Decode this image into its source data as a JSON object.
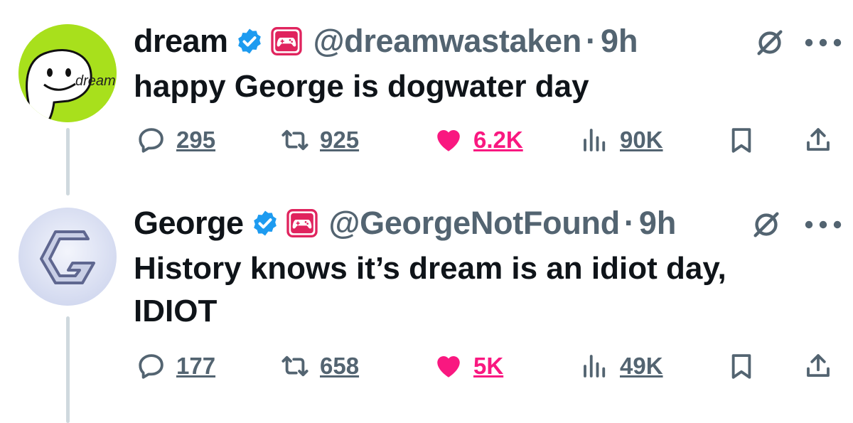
{
  "tweets": [
    {
      "name": "dream",
      "handle": "@dreamwastaken",
      "separator": "·",
      "time": "9h",
      "text": "happy George is dogwater day",
      "avatar_label": "dream",
      "stats": {
        "replies": "295",
        "reposts": "925",
        "likes": "6.2K",
        "views": "90K"
      }
    },
    {
      "name": "George",
      "handle": "@GeorgeNotFound",
      "separator": "·",
      "time": "9h",
      "text": "History knows it’s dream is an idiot day, IDIOT",
      "stats": {
        "replies": "177",
        "reposts": "658",
        "likes": "5K",
        "views": "49K"
      }
    }
  ],
  "colors": {
    "verified": "#1d9bf0",
    "affiliation_badge": "#e0245e",
    "like": "#f91880",
    "muted": "#536471",
    "thread_line": "#cfd9de",
    "dream_avatar_bg": "#a8e01c",
    "george_avatar_bg": "#dde3f5"
  },
  "icons": [
    "verified-badge-icon",
    "gamepad-badge-icon",
    "grok-icon",
    "more-icon",
    "reply-icon",
    "repost-icon",
    "heart-icon",
    "views-icon",
    "bookmark-icon",
    "share-icon"
  ]
}
